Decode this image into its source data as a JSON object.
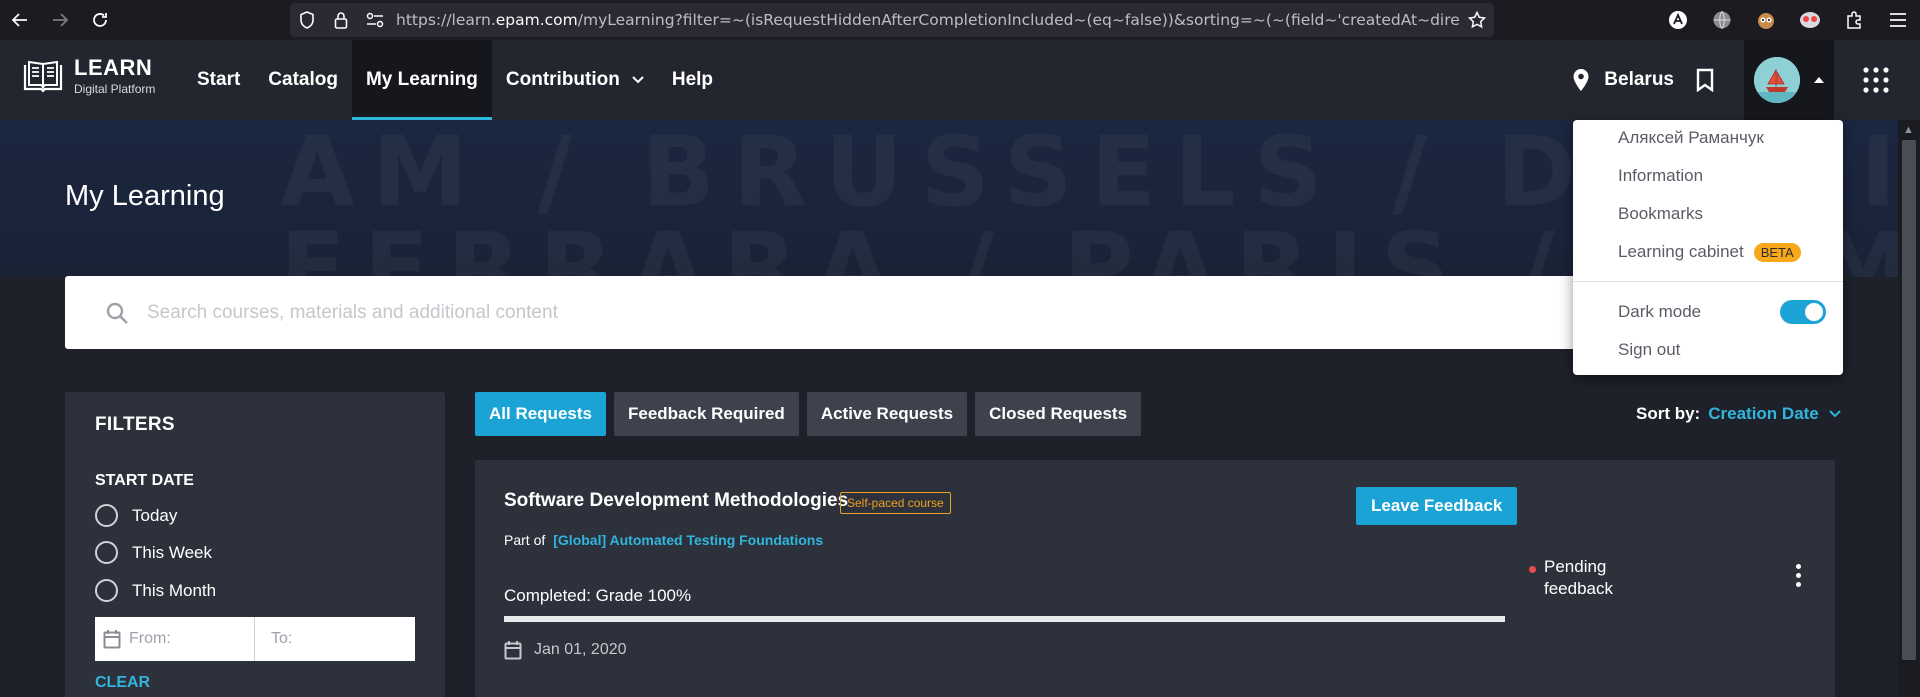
{
  "browser": {
    "url_prefix": "https://learn.",
    "url_domain": "epam.com",
    "url_rest": "/myLearning?filter=~(isRequestHiddenAfterCompletionIncluded~(eq~false))&sorting=~(~(field~'createdAt~directi"
  },
  "header": {
    "logo_title": "LEARN",
    "logo_subtitle": "Digital Platform",
    "nav": [
      "Start",
      "Catalog",
      "My Learning",
      "Contribution",
      "Help"
    ],
    "location": "Belarus"
  },
  "hero": {
    "title": "My Learning",
    "background_text_1": "AM / BRUSSELS / DUBLIN / POTS",
    "background_text_2": "FERRARA / PARIS / ROME / OSLO"
  },
  "search": {
    "placeholder": "Search courses, materials and additional content"
  },
  "filters": {
    "title": "FILTERS",
    "section": "START DATE",
    "options": [
      "Today",
      "This Week",
      "This Month"
    ],
    "from_placeholder": "From:",
    "to_placeholder": "To:",
    "clear": "CLEAR"
  },
  "tabs": [
    "All Requests",
    "Feedback Required",
    "Active Requests",
    "Closed Requests"
  ],
  "sort": {
    "label": "Sort by:",
    "value": "Creation Date"
  },
  "card": {
    "title": "Software Development Methodologies",
    "badge": "Self-paced course",
    "part_of_label": "Part of",
    "part_of_link": "[Global] Automated Testing Foundations",
    "feedback_button": "Leave Feedback",
    "completed": "Completed: Grade 100%",
    "progress": 1.0,
    "date": "Jan 01, 2020",
    "status": "Pending feedback"
  },
  "dropdown": {
    "user_name": "Аляксей Раманчук",
    "items": [
      "Information",
      "Bookmarks",
      "Learning cabinet"
    ],
    "beta": "BETA",
    "dark_mode": "Dark mode",
    "dark_mode_on": true,
    "sign_out": "Sign out"
  },
  "colors": {
    "accent": "#1ca3d6",
    "header_bg": "#23262e",
    "page_bg": "#1e2129",
    "badge": "#f0a020",
    "beta": "#f7a81b",
    "status_dot": "#e84c4c"
  }
}
